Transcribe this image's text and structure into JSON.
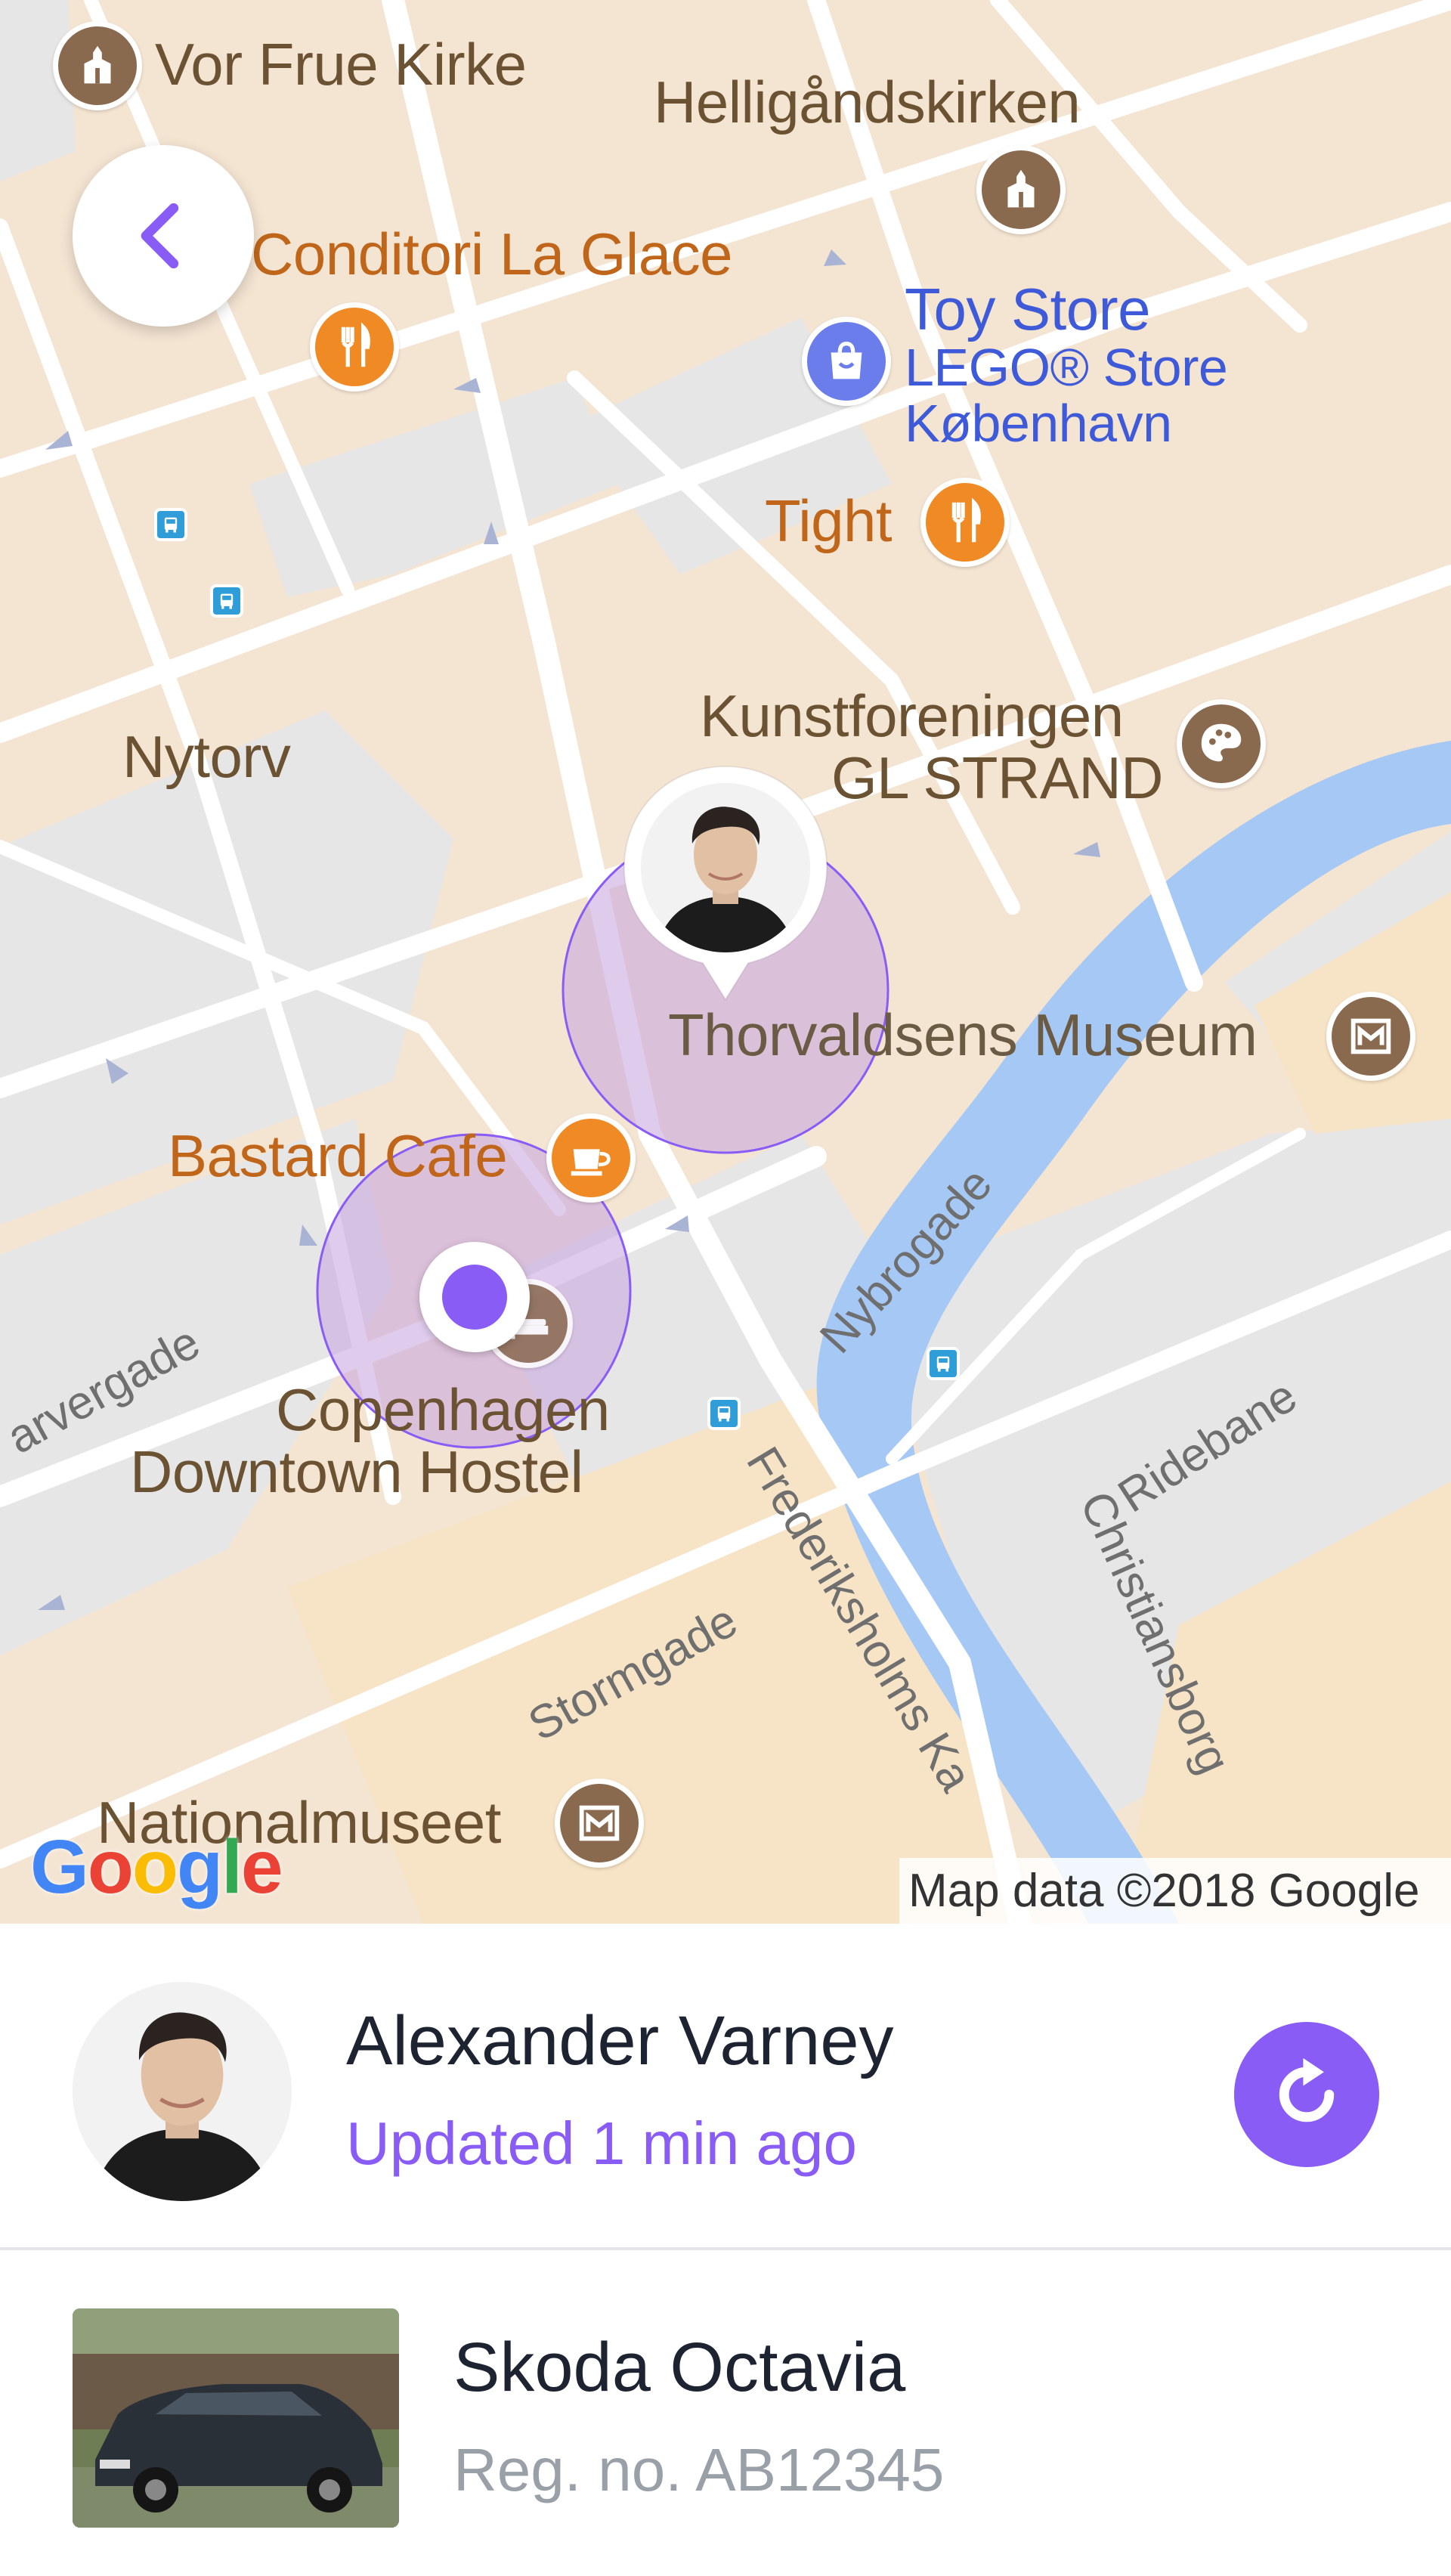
{
  "map": {
    "places": {
      "vor_frue_kirke": "Vor Frue Kirke",
      "helligaandskirken": "Helligåndskirken",
      "conditori_la_glace": "Conditori La Glace",
      "toy_store": "Toy Store",
      "lego_store_line1": "LEGO® Store",
      "lego_store_line2": "København",
      "tight": "Tight",
      "nytorv": "Nytorv",
      "kunstforeningen_line1": "Kunstforeningen",
      "kunstforeningen_line2": "GL STRAND",
      "thorvaldsens_museum": "Thorvaldsens Museum",
      "bastard_cafe": "Bastard Cafe",
      "hostel_line1": "Copenhagen",
      "hostel_line2": "Downtown Hostel",
      "nationalmuseet": "Nationalmuseet"
    },
    "streets": {
      "farvergade": "arvergade",
      "nybrogade": "Nybrogade",
      "stormgade": "Stormgade",
      "frederiksholms": "Frederiksholms Ka",
      "ridebane": "Ridebane",
      "christiansborg": "Christiansborg"
    },
    "logo_letters": [
      "G",
      "o",
      "o",
      "g",
      "l",
      "e"
    ],
    "attribution": "Map data ©2018 Google",
    "colors": {
      "land": "#f4e4d2",
      "block": "#e8e8e8",
      "road": "#ffffff",
      "water": "#a6c8f5",
      "accent": "#8a5cf6",
      "accuracy_circle": "#c9a9e0"
    },
    "icons": {
      "back": "chevron-left-icon",
      "church": "church-icon",
      "restaurant": "fork-knife-icon",
      "shopping": "shopping-bag-icon",
      "art": "palette-icon",
      "museum": "museum-icon",
      "cafe": "coffee-cup-icon",
      "hostel": "bed-icon",
      "bus": "bus-icon"
    }
  },
  "tracked_person": {
    "name": "Alexander Varney",
    "updated": "Updated 1 min ago",
    "refresh_icon": "refresh-icon"
  },
  "vehicle": {
    "name": "Skoda Octavia",
    "registration": "Reg. no. AB12345"
  }
}
